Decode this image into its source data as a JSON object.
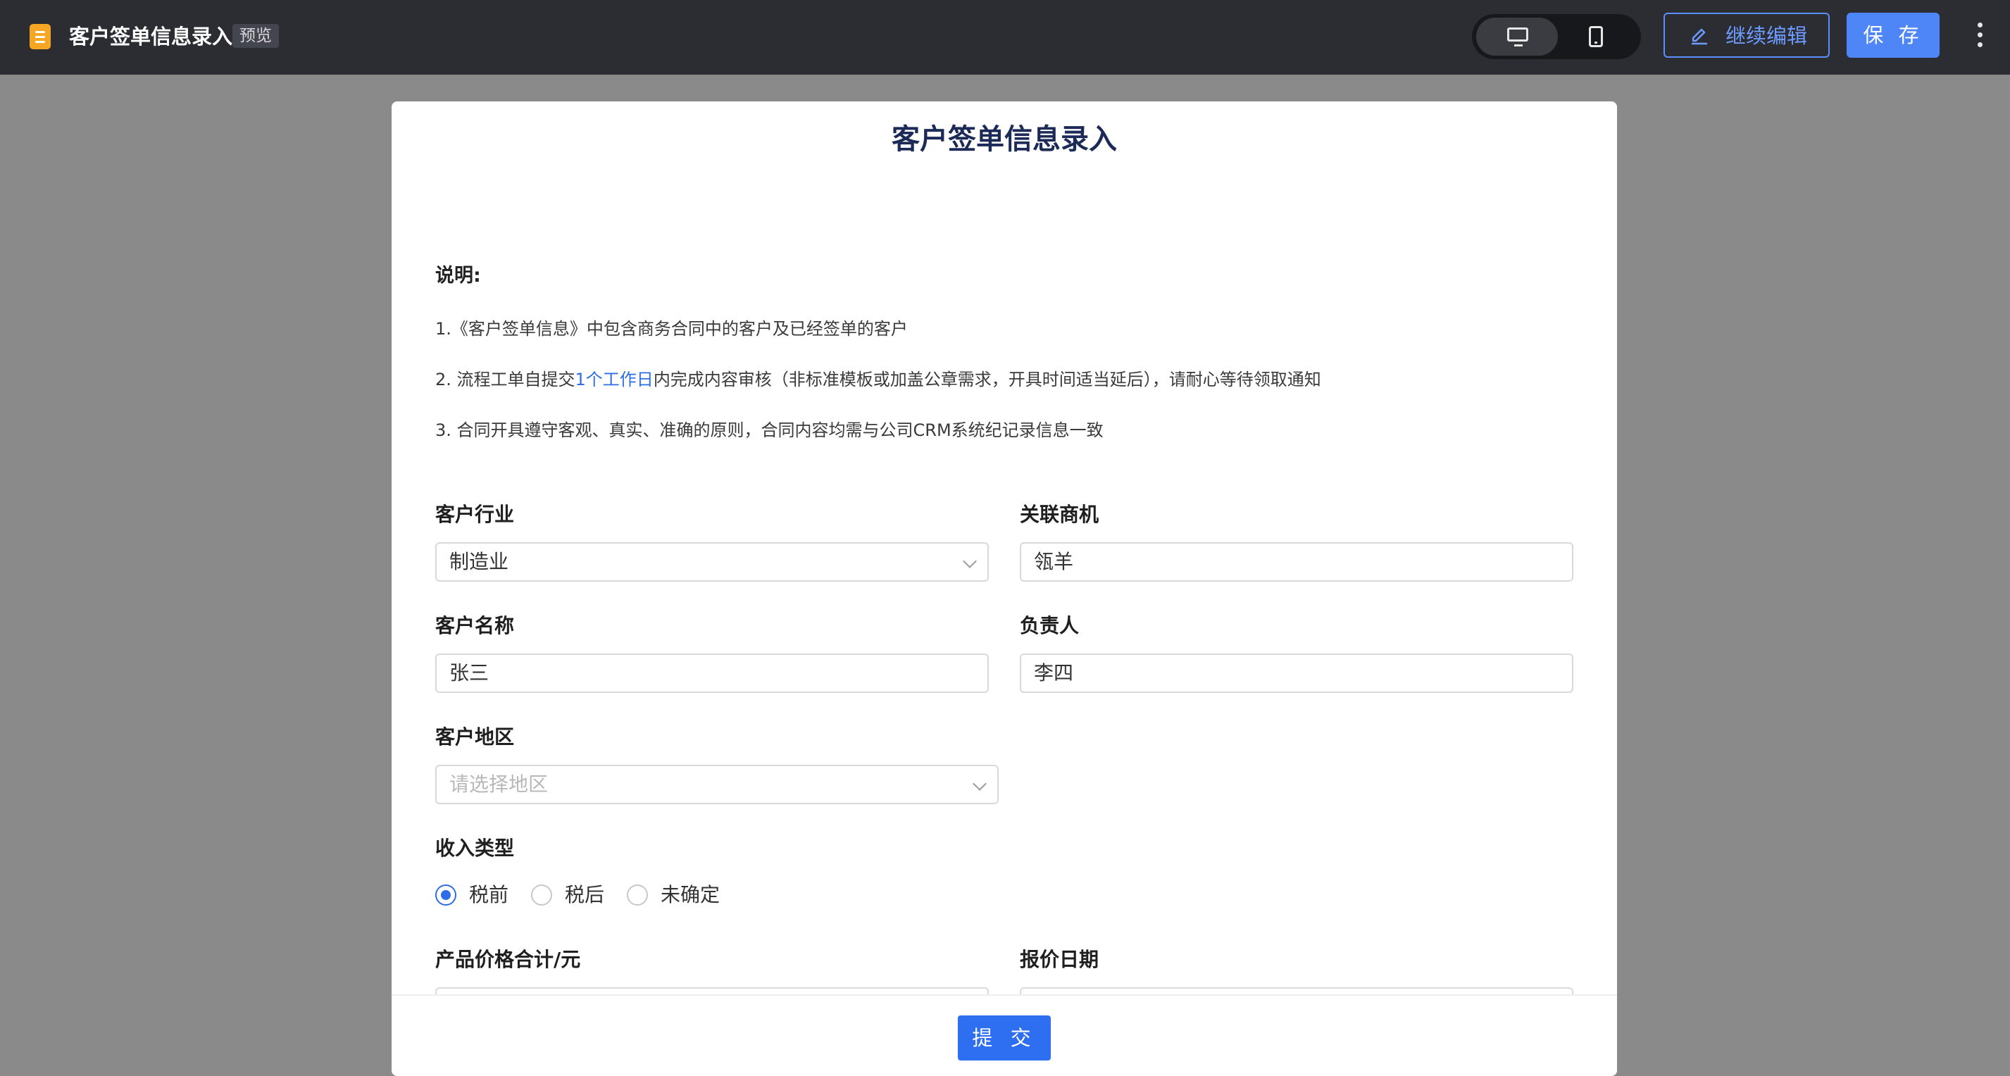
{
  "topbar": {
    "app_title": "客户签单信息录入",
    "preview_badge": "预览",
    "edit_label": "继续编辑",
    "save_label": "保 存",
    "app_icon": "document-icon",
    "device_icons": [
      "desktop-icon",
      "mobile-icon"
    ],
    "more_icon": "more-vertical-icon"
  },
  "form": {
    "title": "客户签单信息录入",
    "description": {
      "label": "说明:",
      "line1": "1.《客户签单信息》中包含商务合同中的客户及已经签单的客户",
      "line2_before": "2. 流程工单自提交",
      "line2_highlight": "1个工作日",
      "line2_after": "内完成内容审核（非标准模板或加盖公章需求，开具时间适当延后），请耐心等待领取通知",
      "line3": "3. 合同开具遵守客观、真实、准确的原则，合同内容均需与公司CRM系统纪记录信息一致"
    },
    "fields": {
      "industry": {
        "label": "客户行业",
        "value": "制造业"
      },
      "opportunity": {
        "label": "关联商机",
        "value": "瓴羊"
      },
      "customer_name": {
        "label": "客户名称",
        "value": "张三"
      },
      "owner": {
        "label": "负责人",
        "value": "李四"
      },
      "region": {
        "label": "客户地区",
        "placeholder": "请选择地区"
      },
      "income_type": {
        "label": "收入类型",
        "options": [
          "税前",
          "税后",
          "未确定"
        ],
        "selected": "税前"
      },
      "price_total": {
        "label": "产品价格合计/元"
      },
      "quote_date": {
        "label": "报价日期"
      }
    },
    "submit_label": "提 交"
  },
  "colors": {
    "topbar_bg": "#2b2d33",
    "accent": "#2f6ee6",
    "save_button": "#4e86f7",
    "page_bg": "#8a8a8a",
    "title_color": "#1b2a56"
  }
}
